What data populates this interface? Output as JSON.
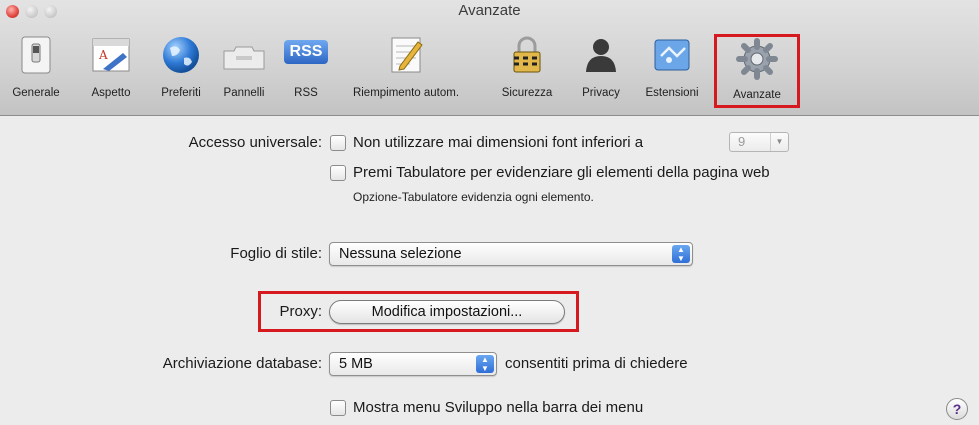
{
  "window": {
    "title": "Avanzate"
  },
  "toolbar": {
    "items": [
      {
        "label": "Generale",
        "icon": "switch-icon"
      },
      {
        "label": "Aspetto",
        "icon": "font-icon"
      },
      {
        "label": "Preferiti",
        "icon": "globe-icon"
      },
      {
        "label": "Pannelli",
        "icon": "tabs-icon"
      },
      {
        "label": "RSS",
        "icon": "rss-icon",
        "icon_text": "RSS"
      },
      {
        "label": "Riempimento autom.",
        "icon": "autofill-icon"
      },
      {
        "label": "Sicurezza",
        "icon": "lock-icon"
      },
      {
        "label": "Privacy",
        "icon": "person-icon"
      },
      {
        "label": "Estensioni",
        "icon": "puzzle-icon"
      },
      {
        "label": "Avanzate",
        "icon": "gear-icon",
        "selected": true
      }
    ]
  },
  "accessibility": {
    "label": "Accesso universale:",
    "min_font_label": "Non utilizzare mai dimensioni font inferiori a",
    "min_font_value": "9",
    "min_font_checked": false,
    "tab_label": "Premi Tabulatore per evidenziare gli elementi della pagina web",
    "tab_checked": false,
    "tab_hint": "Opzione-Tabulatore evidenzia ogni elemento."
  },
  "stylesheet": {
    "label": "Foglio di stile:",
    "value": "Nessuna selezione"
  },
  "proxy": {
    "label": "Proxy:",
    "button": "Modifica impostazioni..."
  },
  "database": {
    "label": "Archiviazione database:",
    "value": "5 MB",
    "suffix": "consentiti prima di chiedere"
  },
  "develop": {
    "label": "Mostra menu Sviluppo nella barra dei menu",
    "checked": false
  },
  "help": {
    "symbol": "?"
  },
  "colors": {
    "highlight": "#d6191f",
    "popup_arrow": "#2f6fd6"
  }
}
